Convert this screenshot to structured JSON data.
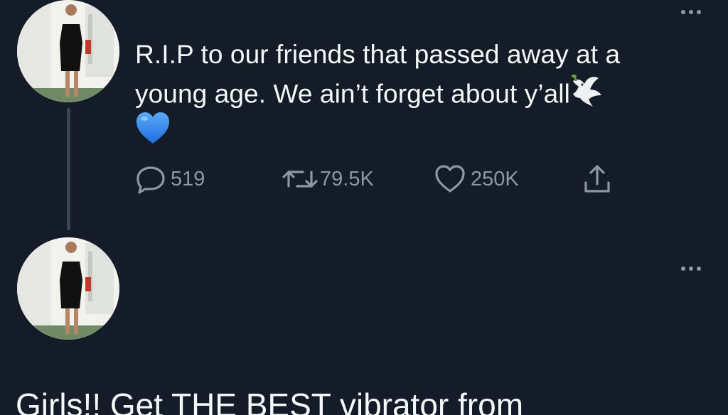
{
  "thread": {
    "first_tweet": {
      "text": "R.I.P to our friends that passed away at a young age. We ain’t forget about y’all",
      "emoji_after_text": "dove-emoji",
      "emoji_line": "blue-heart-emoji",
      "actions": {
        "replies": "519",
        "retweets": "79.5K",
        "likes": "250K"
      }
    },
    "second_tweet": {
      "text": "Girls!! Get THE BEST vibrator from"
    }
  },
  "colors": {
    "background": "#141d27",
    "text": "#f5f8fa",
    "icon": "#8b98a5",
    "thread_line": "#3a4654",
    "heart": "#3b8cf2"
  }
}
